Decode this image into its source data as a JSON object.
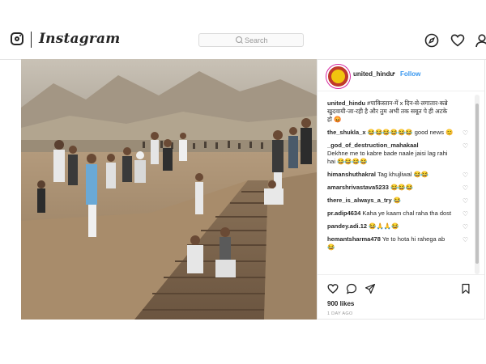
{
  "topbar": {
    "brand": "Instagram",
    "search_placeholder": "Search",
    "icons": [
      "instagram-glyph-icon",
      "compass-icon",
      "heart-icon",
      "person-icon"
    ]
  },
  "post": {
    "username": "united_hindu",
    "separator": "•",
    "follow_label": "Follow",
    "caption_user": "united_hindu",
    "caption_text": "#पाकिस्तान-में x दिन-से-लगातार-कब्रे खुदवायी-जा-रही है और तुम अभी तक सबूत पे ही अटके हो 😡",
    "comments": [
      {
        "user": "the_shukla_x",
        "text": "😂😂😂😂😂😂 good news 😊"
      },
      {
        "user": "_god_of_destruction_mahakaal",
        "text": "Dekhne me to kabre bade naale jaisi lag rahi hai 😂😂😂😂"
      },
      {
        "user": "himanshuthakral",
        "text": "Tag khujliwal 😂😂"
      },
      {
        "user": "amarshrivastava5233",
        "text": "😂😂😂"
      },
      {
        "user": "there_is_always_a_try",
        "text": "😂"
      },
      {
        "user": "pr.adip4634",
        "text": "Kaha ye kaam chal raha tha dost"
      },
      {
        "user": "pandey.adi.12",
        "text": "😂🙏🙏😂"
      },
      {
        "user": "hemantsharma478",
        "text": "Ye to hota hi rahega ab 😂"
      }
    ],
    "likes": "900 likes",
    "time": "1 DAY AGO"
  },
  "colors": {
    "link_blue": "#3897f0",
    "text_dark": "#262626",
    "muted": "#999999",
    "border": "#dbdbdb"
  }
}
